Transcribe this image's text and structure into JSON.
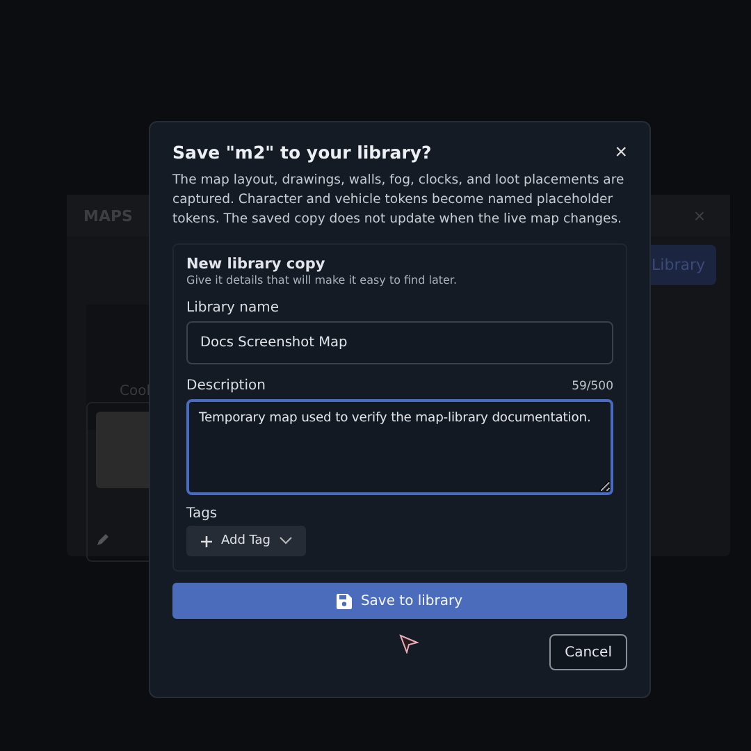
{
  "background": {
    "panel_title": "MAPS",
    "close": "×",
    "button": "Library",
    "card_text": "Cool"
  },
  "dialog": {
    "title": "Save \"m2\" to your library?",
    "close": "×",
    "description": "The map layout, drawings, walls, fog, clocks, and loot placements are captured. Character and vehicle tokens become named placeholder tokens. The saved copy does not update when the live map changes.",
    "section": {
      "title": "New library copy",
      "subtitle": "Give it details that will make it easy to find later.",
      "fields": [
        {
          "kind": "input",
          "label": "Library name",
          "value": "Docs Screenshot Map",
          "focused": false
        },
        {
          "kind": "textarea",
          "label": "Description",
          "counter": "59/500",
          "value": "Temporary map used to verify the map-library documentation.",
          "focused": true
        }
      ],
      "tags": {
        "label": "Tags",
        "button": "Add Tag"
      }
    },
    "primary_button": "Save to library",
    "secondary_button": "Cancel"
  }
}
